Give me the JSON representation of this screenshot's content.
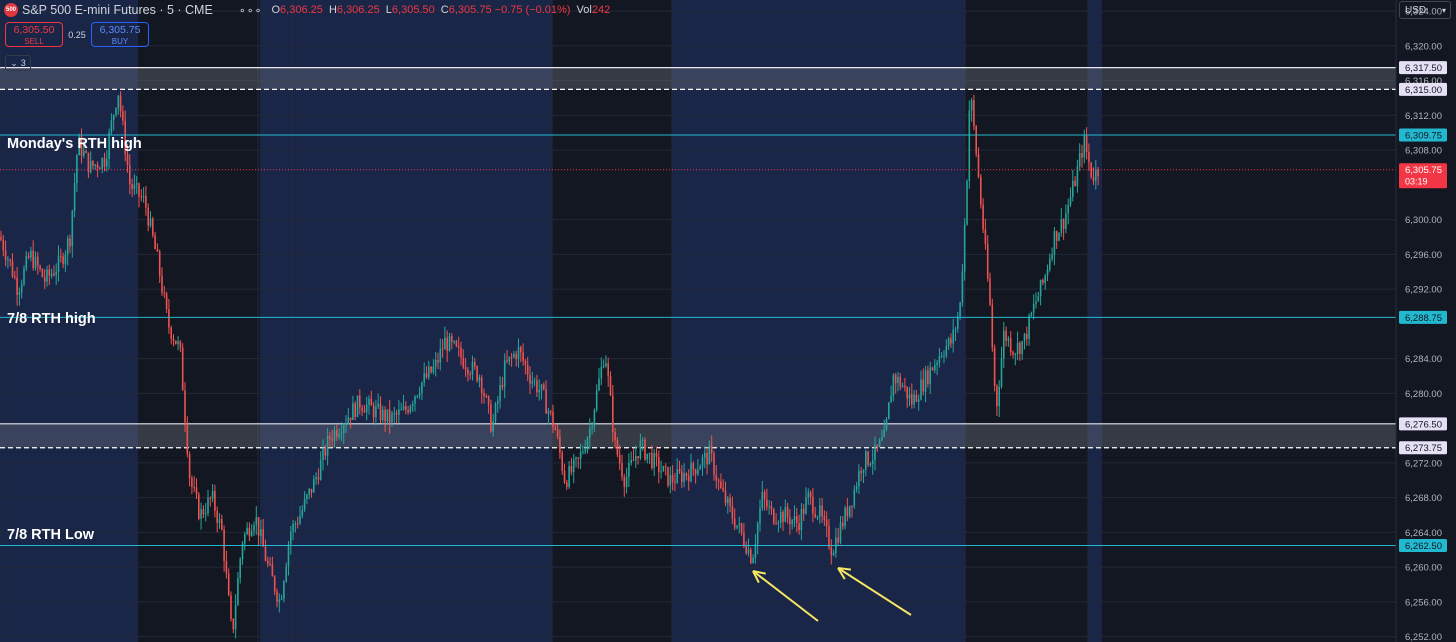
{
  "header": {
    "logo_text": "500",
    "symbol": "S&P 500 E-mini Futures · 5 · CME",
    "more_icon": "more-dots-icon",
    "ohlc": {
      "o_label": "O",
      "o": "6,306.25",
      "h_label": "H",
      "h": "6,306.25",
      "l_label": "L",
      "l": "6,305.50",
      "c_label": "C",
      "c": "6,305.75",
      "change": "−0.75 (−0.01%)",
      "vol_label": "Vol",
      "vol": "242"
    }
  },
  "trade": {
    "sell_price": "6,305.50",
    "sell_label": "SELL",
    "spread": "0.25",
    "buy_price": "6,305.75",
    "buy_label": "BUY"
  },
  "indicators": {
    "count": "3"
  },
  "currency": "USD",
  "colors": {
    "background": "#131722",
    "session_shade": "#192647",
    "up": "#26a69a",
    "down": "#ef5350",
    "level_line": "#22b8cf",
    "zone": "#787b86",
    "arrow": "#f5e663",
    "price_tag": "#f23645"
  },
  "annotations": {
    "monday_rth_high": "Monday's RTH high",
    "rth_high_7_8": "7/8 RTH high",
    "rth_low_7_8": "7/8 RTH Low"
  },
  "price_axis": {
    "ticks": [
      "6,324.00",
      "6,320.00",
      "6,316.00",
      "6,312.00",
      "6,308.00",
      "6,300.00",
      "6,296.00",
      "6,292.00",
      "6,284.00",
      "6,280.00",
      "6,272.00",
      "6,268.00",
      "6,264.00",
      "6,260.00",
      "6,256.00",
      "6,252.00"
    ],
    "min": 6252,
    "max": 6325
  },
  "levels": {
    "zones": [
      {
        "top": 6317.5,
        "bottom": 6315.0,
        "top_label": "6,317.50",
        "bottom_label": "6,315.00"
      },
      {
        "top": 6276.5,
        "bottom": 6273.75,
        "top_label": "6,276.50",
        "bottom_label": "6,273.75"
      }
    ],
    "lines": [
      {
        "price": 6309.75,
        "label": "6,309.75"
      },
      {
        "price": 6288.75,
        "label": "6,288.75"
      },
      {
        "price": 6262.5,
        "label": "6,262.50"
      }
    ],
    "last_price": {
      "price": 6305.75,
      "label": "6,305.75",
      "countdown": "03:19"
    }
  },
  "chart_data": {
    "type": "candlestick",
    "x_unit": "5-minute bars",
    "y_range": [
      6252,
      6325
    ],
    "close_path": [
      [
        0,
        6298
      ],
      [
        10,
        6295
      ],
      [
        18,
        6292
      ],
      [
        30,
        6296
      ],
      [
        45,
        6293
      ],
      [
        60,
        6295
      ],
      [
        70,
        6298
      ],
      [
        78,
        6309
      ],
      [
        90,
        6306
      ],
      [
        105,
        6307
      ],
      [
        118,
        6315
      ],
      [
        130,
        6304
      ],
      [
        145,
        6302
      ],
      [
        158,
        6295
      ],
      [
        168,
        6288
      ],
      [
        180,
        6285
      ],
      [
        190,
        6270
      ],
      [
        200,
        6266
      ],
      [
        212,
        6268
      ],
      [
        222,
        6264
      ],
      [
        232,
        6252
      ],
      [
        242,
        6263
      ],
      [
        255,
        6266
      ],
      [
        268,
        6260
      ],
      [
        280,
        6256
      ],
      [
        290,
        6264
      ],
      [
        300,
        6266
      ],
      [
        315,
        6270
      ],
      [
        330,
        6275
      ],
      [
        345,
        6277
      ],
      [
        360,
        6279
      ],
      [
        375,
        6278
      ],
      [
        390,
        6277
      ],
      [
        405,
        6278
      ],
      [
        420,
        6281
      ],
      [
        435,
        6283
      ],
      [
        445,
        6286
      ],
      [
        455,
        6285
      ],
      [
        470,
        6283
      ],
      [
        480,
        6282
      ],
      [
        492,
        6276
      ],
      [
        505,
        6283
      ],
      [
        518,
        6285
      ],
      [
        530,
        6282
      ],
      [
        542,
        6280
      ],
      [
        555,
        6276
      ],
      [
        565,
        6270
      ],
      [
        578,
        6272
      ],
      [
        590,
        6276
      ],
      [
        605,
        6285
      ],
      [
        615,
        6274
      ],
      [
        625,
        6270
      ],
      [
        640,
        6274
      ],
      [
        655,
        6272
      ],
      [
        670,
        6270
      ],
      [
        690,
        6271
      ],
      [
        710,
        6273
      ],
      [
        720,
        6269
      ],
      [
        732,
        6266
      ],
      [
        745,
        6263
      ],
      [
        752,
        6261
      ],
      [
        762,
        6268
      ],
      [
        772,
        6266
      ],
      [
        785,
        6266
      ],
      [
        798,
        6265
      ],
      [
        808,
        6268
      ],
      [
        820,
        6266
      ],
      [
        832,
        6262
      ],
      [
        842,
        6265
      ],
      [
        852,
        6268
      ],
      [
        862,
        6272
      ],
      [
        875,
        6273
      ],
      [
        885,
        6275
      ],
      [
        893,
        6282
      ],
      [
        902,
        6281
      ],
      [
        912,
        6279
      ],
      [
        922,
        6281
      ],
      [
        932,
        6283
      ],
      [
        942,
        6285
      ],
      [
        952,
        6286
      ],
      [
        960,
        6290
      ],
      [
        966,
        6302
      ],
      [
        970,
        6315
      ],
      [
        976,
        6308
      ],
      [
        984,
        6298
      ],
      [
        990,
        6290
      ],
      [
        996,
        6278
      ],
      [
        1004,
        6287
      ],
      [
        1014,
        6285
      ],
      [
        1024,
        6286
      ],
      [
        1034,
        6290
      ],
      [
        1044,
        6293
      ],
      [
        1054,
        6298
      ],
      [
        1064,
        6300
      ],
      [
        1074,
        6304
      ],
      [
        1084,
        6309
      ],
      [
        1092,
        6305
      ],
      [
        1100,
        6306
      ]
    ]
  }
}
